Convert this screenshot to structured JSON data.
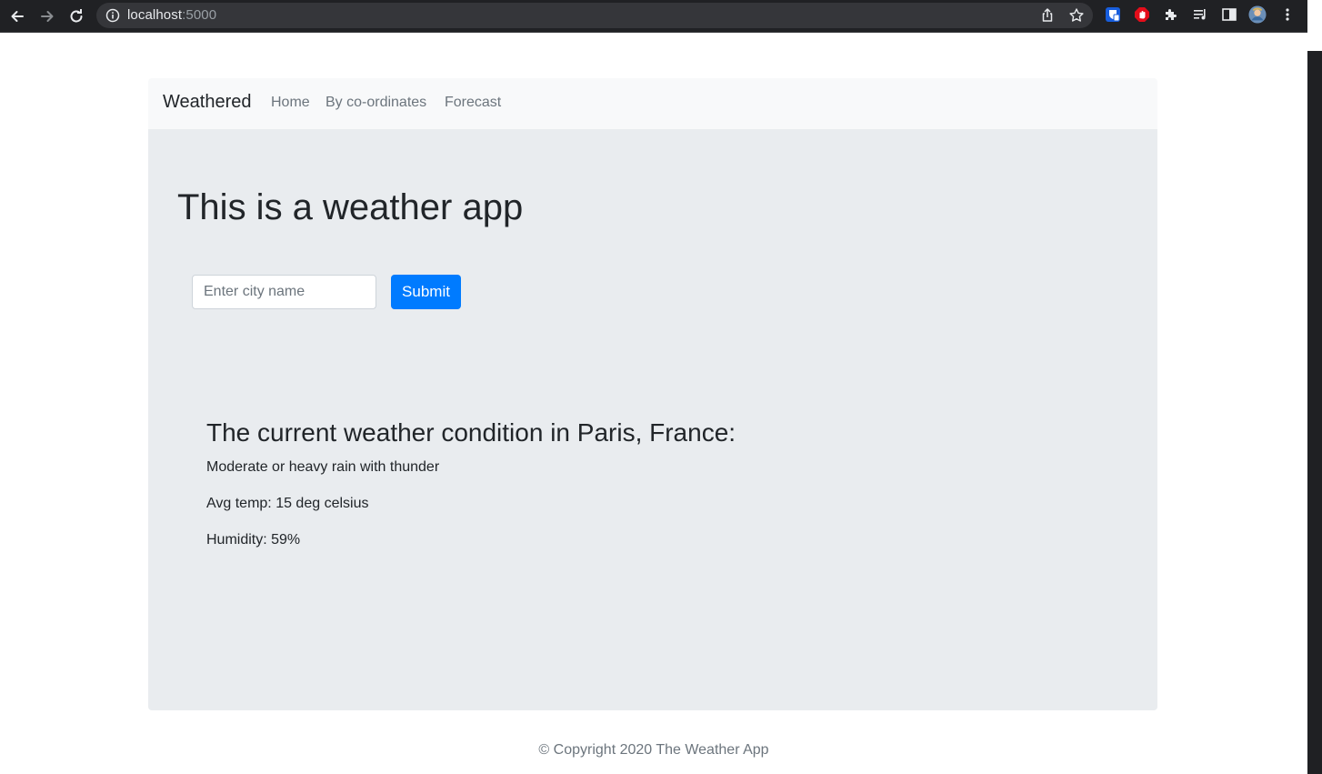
{
  "browser": {
    "url_host": "localhost",
    "url_port": ":5000",
    "icons": [
      "back-arrow-icon",
      "forward-arrow-icon",
      "reload-icon",
      "info-icon",
      "share-icon",
      "bookmark-star-icon",
      "bitwarden-icon",
      "adblock-icon",
      "extensions-puzzle-icon",
      "media-queue-icon",
      "side-panel-icon",
      "profile-avatar-icon",
      "menu-kebab-icon"
    ]
  },
  "navbar": {
    "brand": "Weathered",
    "links": [
      "Home",
      "By co-ordinates",
      "Forecast"
    ]
  },
  "main": {
    "headline": "This is a weather app",
    "city_input_placeholder": "Enter city name",
    "submit_label": "Submit"
  },
  "result": {
    "title": "The current weather condition in Paris, France:",
    "condition": "Moderate or heavy rain with thunder",
    "avg_temp": "Avg temp: 15 deg celsius",
    "humidity": "Humidity: 59%"
  },
  "footer": {
    "text": "© Copyright 2020 The Weather App"
  },
  "colors": {
    "primary": "#007bff",
    "navbar_bg": "#f8f9fa",
    "jumbotron_bg": "#e9ecef",
    "chrome_bg": "#202124"
  }
}
